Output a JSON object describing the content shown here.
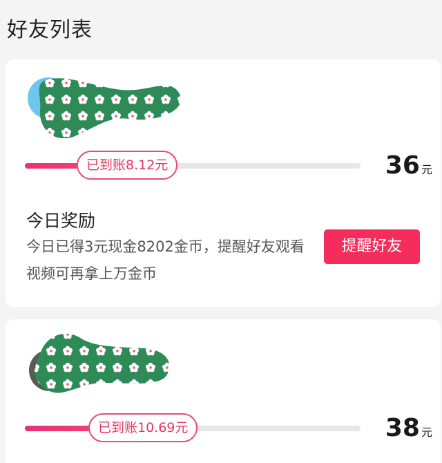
{
  "page": {
    "title": "好友列表"
  },
  "friends": [
    {
      "progress_label": "已到账8.12元",
      "progress_fraction": 0.22,
      "amount": "36",
      "unit": "元",
      "reward_title": "今日奖励",
      "reward_desc": "今日已得3元现金8202金币，提醒好友观看视频可再拿上万金币",
      "button_label": "提醒好友"
    },
    {
      "progress_label": "已到账10.69元",
      "progress_fraction": 0.29,
      "amount": "38",
      "unit": "元"
    }
  ],
  "colors": {
    "accent": "#f42d5c",
    "progress_fill": "#e6327a",
    "privacy_mask": "#2e8a57",
    "avatar_blue": "#6cc6ee"
  }
}
